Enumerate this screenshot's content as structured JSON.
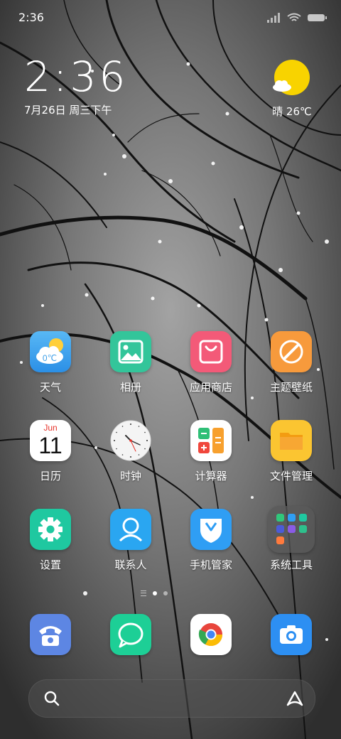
{
  "status_bar": {
    "time": "2:36",
    "icons": [
      "signal-icon",
      "wifi-icon",
      "battery-icon"
    ]
  },
  "clock_widget": {
    "time": "2:36",
    "date": "7月26日 周三下午"
  },
  "weather_widget": {
    "icon": "sunny-cloud-icon",
    "text": "晴 26℃"
  },
  "apps": [
    {
      "id": "weather",
      "label": "天气",
      "icon": "weather-icon",
      "badge": "0℃"
    },
    {
      "id": "gallery",
      "label": "相册",
      "icon": "gallery-icon"
    },
    {
      "id": "app-store",
      "label": "应用商店",
      "icon": "shopping-bag-icon"
    },
    {
      "id": "themes",
      "label": "主题壁纸",
      "icon": "brush-icon"
    },
    {
      "id": "calendar",
      "label": "日历",
      "icon": "calendar-icon",
      "month": "Jun",
      "day": "11"
    },
    {
      "id": "clock",
      "label": "时钟",
      "icon": "clock-icon"
    },
    {
      "id": "calculator",
      "label": "计算器",
      "icon": "calculator-icon"
    },
    {
      "id": "file-manager",
      "label": "文件管理",
      "icon": "folder-icon"
    },
    {
      "id": "settings",
      "label": "设置",
      "icon": "gear-icon"
    },
    {
      "id": "contacts",
      "label": "联系人",
      "icon": "contacts-icon"
    },
    {
      "id": "phone-manager",
      "label": "手机管家",
      "icon": "shield-icon"
    },
    {
      "id": "system-tools",
      "label": "系统工具",
      "icon": "folder-grid-icon"
    }
  ],
  "page_indicator": {
    "pages": 2,
    "current": 1
  },
  "dock": [
    {
      "id": "phone",
      "icon": "phone-icon"
    },
    {
      "id": "messages",
      "icon": "message-icon"
    },
    {
      "id": "browser",
      "icon": "chrome-icon"
    },
    {
      "id": "camera",
      "icon": "camera-icon"
    }
  ],
  "search_bar": {
    "left_icon": "search-icon",
    "right_icon": "assistant-icon"
  },
  "colors": {
    "weather_bg": "#3da8ee",
    "gallery_bg": "#33c59a",
    "store_bg": "#f35a78",
    "themes_bg": "#f79a3c",
    "calendar_bg": "#ffffff",
    "calendar_month": "#e6332a",
    "calculator_bg": "#ffffff",
    "folder_bg": "#fbc531",
    "settings_bg": "#1fc8a0",
    "contacts_bg": "#2aa6f1",
    "manager_bg": "#2f9ef4",
    "phone_bg": "#5d86e3",
    "message_bg": "#1dcf96",
    "camera_bg": "#2d8ff2",
    "sun": "#f8d300"
  }
}
